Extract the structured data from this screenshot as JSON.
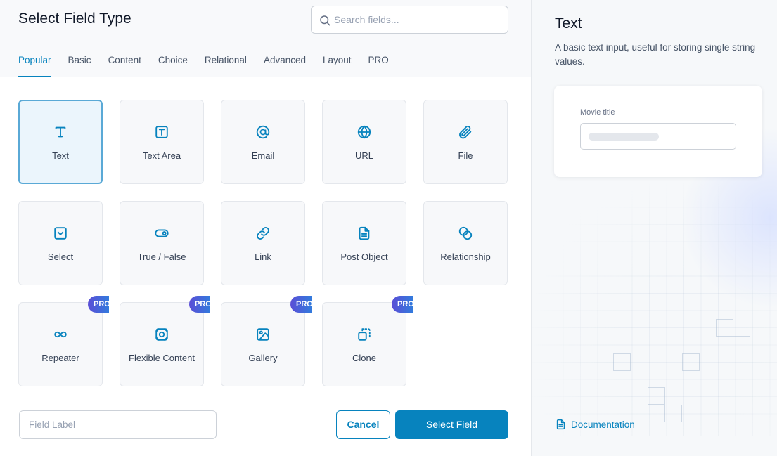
{
  "header": {
    "title": "Select Field Type",
    "search_placeholder": "Search fields..."
  },
  "tabs": [
    {
      "label": "Popular",
      "active": true
    },
    {
      "label": "Basic"
    },
    {
      "label": "Content"
    },
    {
      "label": "Choice"
    },
    {
      "label": "Relational"
    },
    {
      "label": "Advanced"
    },
    {
      "label": "Layout"
    },
    {
      "label": "PRO"
    }
  ],
  "fields": [
    {
      "label": "Text",
      "icon": "text-icon",
      "selected": true
    },
    {
      "label": "Text Area",
      "icon": "textarea-icon"
    },
    {
      "label": "Email",
      "icon": "at-sign-icon"
    },
    {
      "label": "URL",
      "icon": "globe-icon"
    },
    {
      "label": "File",
      "icon": "paperclip-icon"
    },
    {
      "label": "Select",
      "icon": "select-chevron-icon"
    },
    {
      "label": "True / False",
      "icon": "toggle-icon"
    },
    {
      "label": "Link",
      "icon": "link-icon"
    },
    {
      "label": "Post Object",
      "icon": "document-icon"
    },
    {
      "label": "Relationship",
      "icon": "relationship-icon"
    },
    {
      "label": "Repeater",
      "icon": "infinity-icon",
      "pro": true
    },
    {
      "label": "Flexible Content",
      "icon": "flexible-content-icon",
      "pro": true
    },
    {
      "label": "Gallery",
      "icon": "image-icon",
      "pro": true
    },
    {
      "label": "Clone",
      "icon": "clone-icon",
      "pro": true
    }
  ],
  "pro_badge": "PRO",
  "footer": {
    "field_label_placeholder": "Field Label",
    "cancel_label": "Cancel",
    "select_label": "Select Field"
  },
  "preview": {
    "title": "Text",
    "description": "A basic text input, useful for storing single string values.",
    "example_label": "Movie title",
    "doc_link": "Documentation"
  },
  "colors": {
    "accent": "#0783be",
    "pro_gradient_start": "#5b4ed6",
    "pro_gradient_end": "#1f8fe0"
  }
}
